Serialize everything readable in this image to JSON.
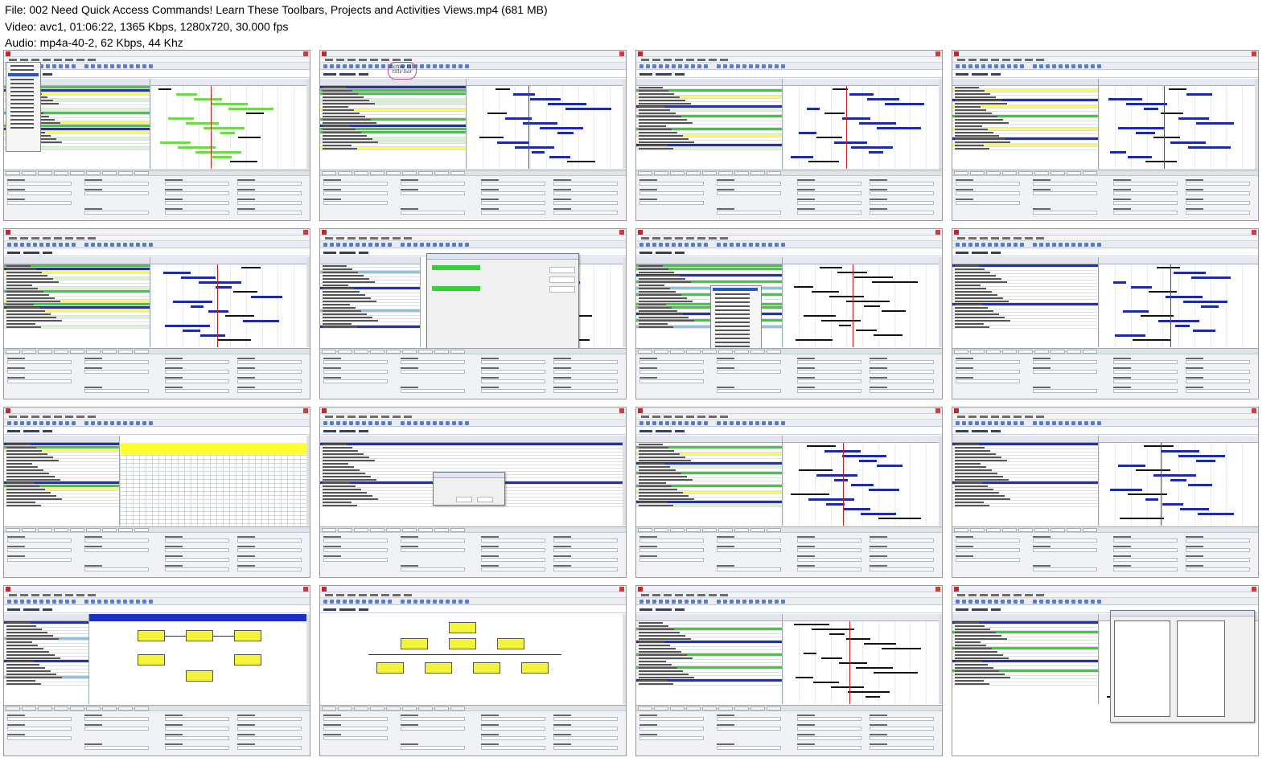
{
  "header": {
    "line1": "File: 002 Need Quick Access Commands! Learn These Toolbars, Projects and Activities Views.mp4 (681 MB)",
    "line2": "Video: avc1, 01:06:22, 1365 Kbps, 1280x720, 30.000 fps",
    "line3": "Audio: mp4a-40-2, 62 Kbps, 44 Khz"
  },
  "annotation": {
    "text": "Active tab title bar"
  },
  "colors": {
    "accent_green": "#36d13a",
    "selection_blue": "#1d2fc4",
    "highlight_yellow": "#ffff33",
    "gantt_bar_blue": "#1f2aa7",
    "data_date_red": "#d11919",
    "app_logo_red": "#c0282d"
  },
  "icons": {
    "window_close": "close-icon",
    "app_logo": "app-logo-icon"
  }
}
